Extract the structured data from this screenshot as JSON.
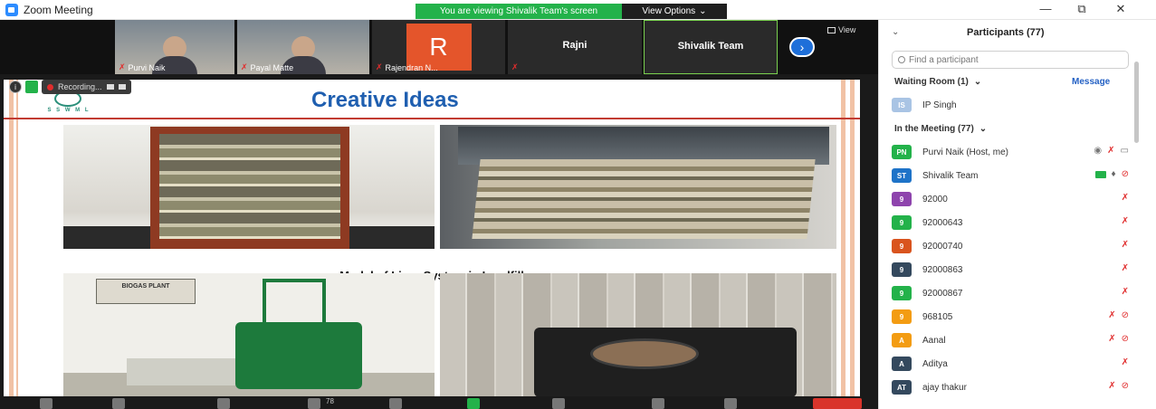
{
  "window": {
    "title": "Zoom Meeting",
    "minimize": "—",
    "maximize": "⧉",
    "close": "✕"
  },
  "share_banner": {
    "viewing_text": "You are viewing Shivalik Team's screen",
    "view_options": "View Options",
    "chevron": "⌄"
  },
  "gallery": {
    "tiles": [
      {
        "name": "Purvi Naik"
      },
      {
        "name": "Payal Matte"
      },
      {
        "name": "Rajendran N...",
        "initial": "R"
      },
      {
        "name": "Rajni"
      },
      {
        "name": "Shivalik Team"
      }
    ],
    "next": "›",
    "view_label": "View"
  },
  "recording": {
    "label": "Recording...",
    "info": "i"
  },
  "slide": {
    "logo_text": "S S W M L",
    "title": "Creative Ideas",
    "caption": "Model of Liner System in Landfill",
    "sign_text": "BIOGAS PLANT"
  },
  "toolbar": {
    "participants_count": "78"
  },
  "participants": {
    "title": "Participants (77)",
    "chevron": "⌄",
    "search_placeholder": "Find a participant",
    "waiting_room": {
      "label": "Waiting Room (1)",
      "chevron": "⌄",
      "message_link": "Message",
      "people": [
        {
          "initials": "IS",
          "name": "IP Singh",
          "color": "#a9c4e4"
        }
      ]
    },
    "in_meeting": {
      "label": "In the Meeting (77)",
      "chevron": "⌄",
      "people": [
        {
          "initials": "PN",
          "name": "Purvi Naik (Host, me)",
          "color": "#23b24a"
        },
        {
          "initials": "ST",
          "name": "Shivalik Team",
          "color": "#1e73c8"
        },
        {
          "initials": "9",
          "name": "92000",
          "color": "#8e44ad"
        },
        {
          "initials": "9",
          "name": "92000643",
          "color": "#23b24a"
        },
        {
          "initials": "9",
          "name": "92000740",
          "color": "#d9541e"
        },
        {
          "initials": "9",
          "name": "92000863",
          "color": "#34495e"
        },
        {
          "initials": "9",
          "name": "92000867",
          "color": "#23b24a"
        },
        {
          "initials": "9",
          "name": "968105",
          "color": "#f39c12"
        },
        {
          "initials": "A",
          "name": "Aanal",
          "color": "#f39c12"
        },
        {
          "initials": "A",
          "name": "Aditya",
          "color": "#34495e"
        },
        {
          "initials": "AT",
          "name": "ajay thakur",
          "color": "#34495e"
        }
      ]
    }
  },
  "colors": {
    "accent": "#2d8cff",
    "banner_green": "#23b24a",
    "mute_red": "#e02d2d",
    "slide_title_blue": "#1f5fb0"
  },
  "icons": [
    "zoom-app-icon",
    "info-icon",
    "shield-icon",
    "record-icon",
    "pause-icon",
    "stop-icon",
    "next-arrow-icon",
    "view-grid-icon",
    "search-icon",
    "muted-mic-icon",
    "video-off-icon",
    "mic-icon",
    "screen-share-icon",
    "eye-icon",
    "camera-icon"
  ]
}
